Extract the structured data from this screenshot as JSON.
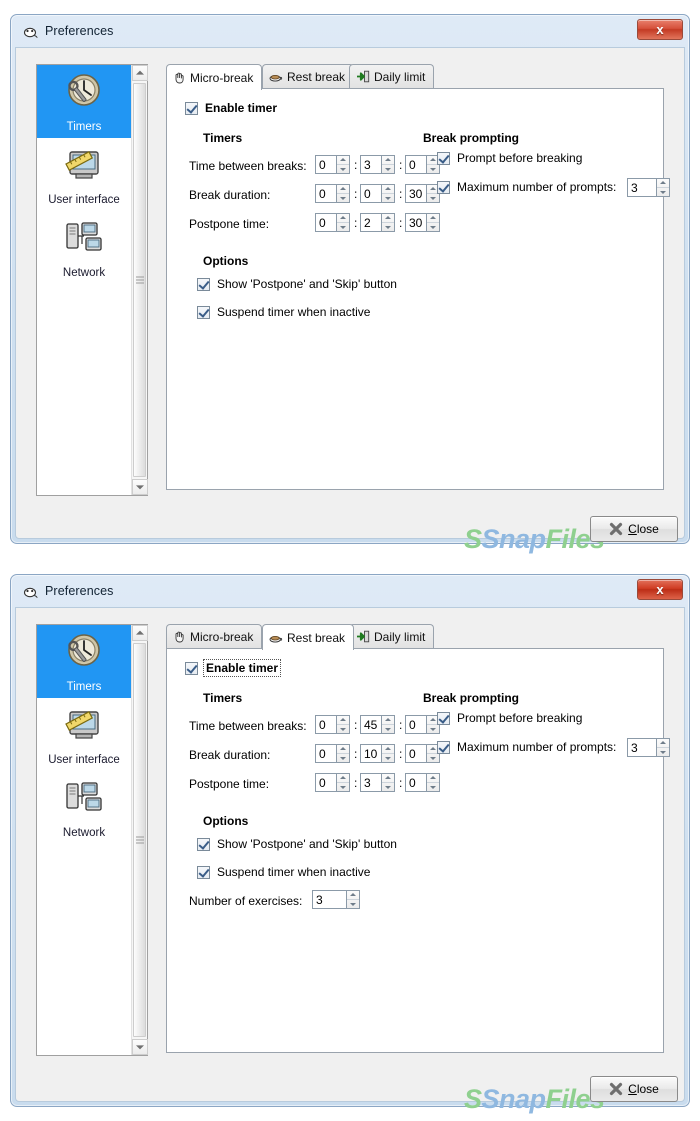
{
  "window": {
    "title": "Preferences",
    "title_icon": "app-icon",
    "close_x_label": "x"
  },
  "sidebar": {
    "items": [
      {
        "label": "Timers",
        "icon": "clock-wrench-icon",
        "selected": true
      },
      {
        "label": "User interface",
        "icon": "monitor-ruler-icon",
        "selected": false
      },
      {
        "label": "Network",
        "icon": "network-computers-icon",
        "selected": false
      }
    ],
    "scrollbar": {
      "up_arrow": "scroll-up-arrow",
      "down_arrow": "scroll-down-arrow"
    }
  },
  "tabs": [
    {
      "label": "Micro-break",
      "icon": "hand-icon"
    },
    {
      "label": "Rest break",
      "icon": "coffee-cup-icon"
    },
    {
      "label": "Daily limit",
      "icon": "green-arrow-door-icon"
    }
  ],
  "footer": {
    "close_label_prefix": "",
    "close_label_accel": "C",
    "close_label_rest": "lose",
    "close_icon": "x-mark-icon"
  },
  "watermark": {
    "s": "S",
    "snap": "Snap",
    "files": "Files"
  },
  "panels": {
    "micro_break": {
      "active_tab": "Micro-break",
      "enable_timer": {
        "label": "Enable timer",
        "checked": true,
        "focused": false
      },
      "timers_header": "Timers",
      "break_prompting_header": "Break prompting",
      "options_header": "Options",
      "rows": [
        {
          "label": "Time between breaks:",
          "values": [
            "0",
            "3",
            "0"
          ]
        },
        {
          "label": "Break duration:",
          "values": [
            "0",
            "0",
            "30"
          ]
        },
        {
          "label": "Postpone time:",
          "values": [
            "0",
            "2",
            "30"
          ]
        }
      ],
      "prompt_before_breaking": {
        "label": "Prompt before breaking",
        "checked": true
      },
      "max_prompts": {
        "label": "Maximum number of prompts:",
        "checked": true,
        "value": "3"
      },
      "options": [
        {
          "label": "Show 'Postpone' and 'Skip' button",
          "checked": true
        },
        {
          "label": "Suspend timer when inactive",
          "checked": true
        }
      ],
      "exercises": null
    },
    "rest_break": {
      "active_tab": "Rest break",
      "enable_timer": {
        "label": "Enable timer",
        "checked": true,
        "focused": true
      },
      "timers_header": "Timers",
      "break_prompting_header": "Break prompting",
      "options_header": "Options",
      "rows": [
        {
          "label": "Time between breaks:",
          "values": [
            "0",
            "45",
            "0"
          ]
        },
        {
          "label": "Break duration:",
          "values": [
            "0",
            "10",
            "0"
          ]
        },
        {
          "label": "Postpone time:",
          "values": [
            "0",
            "3",
            "0"
          ]
        }
      ],
      "prompt_before_breaking": {
        "label": "Prompt before breaking",
        "checked": true
      },
      "max_prompts": {
        "label": "Maximum number of prompts:",
        "checked": true,
        "value": "3"
      },
      "options": [
        {
          "label": "Show 'Postpone' and 'Skip' button",
          "checked": true
        },
        {
          "label": "Suspend timer when inactive",
          "checked": true
        }
      ],
      "exercises": {
        "label": "Number of exercises:",
        "value": "3"
      }
    }
  }
}
